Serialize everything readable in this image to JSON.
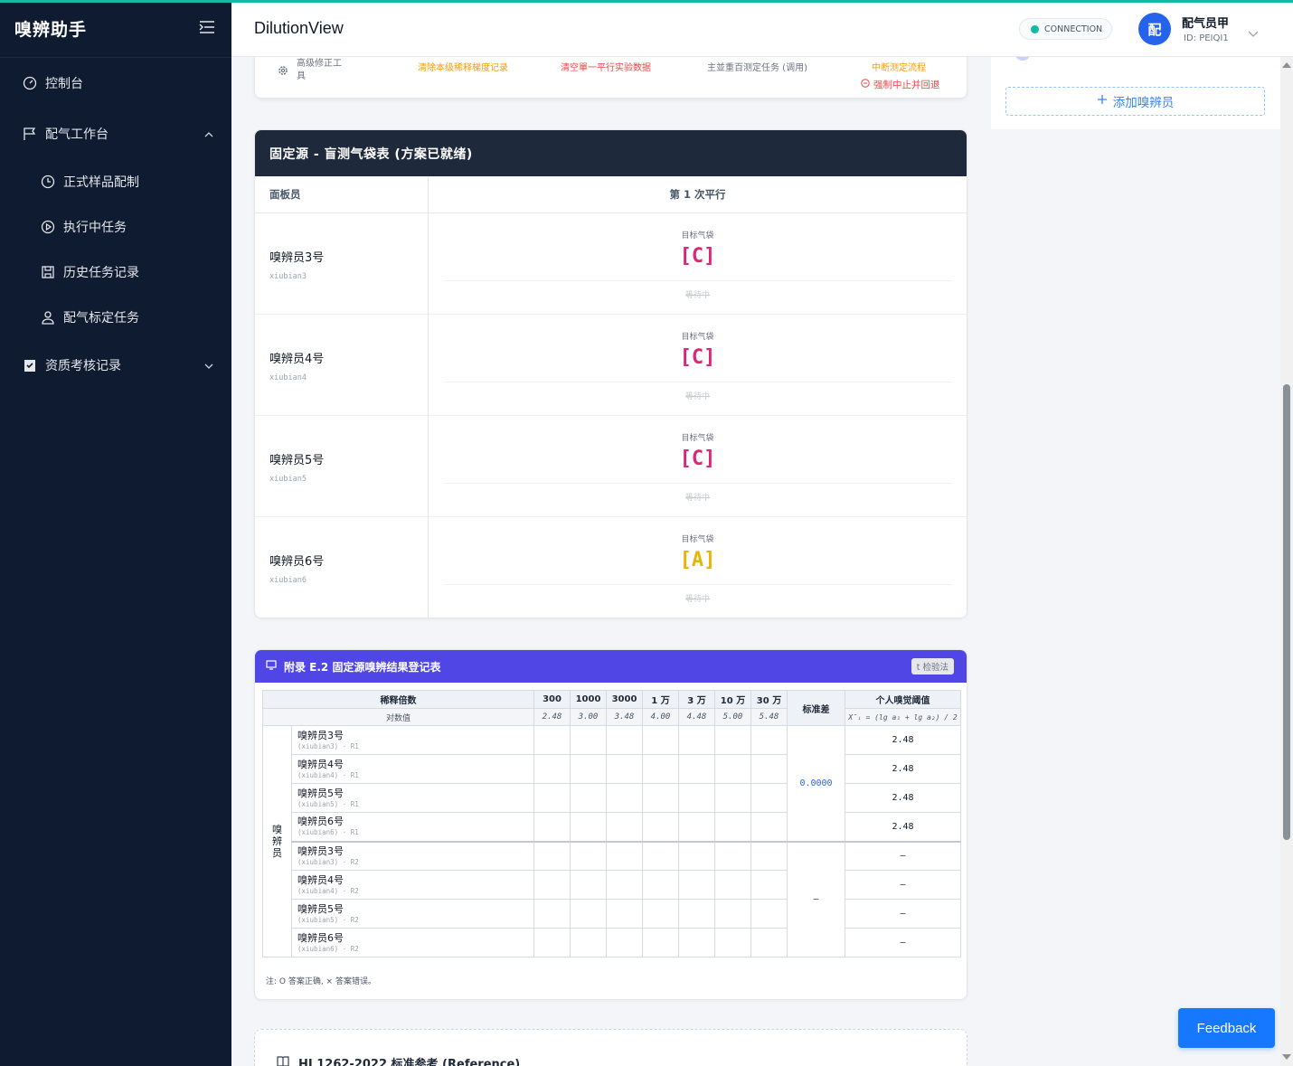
{
  "sidebar": {
    "brand": "嗅辨助手",
    "items": {
      "dashboard": "控制台",
      "workbench": "配气工作台",
      "formal": "正式样品配制",
      "running": "执行中任务",
      "history": "历史任务记录",
      "calibration": "配气标定任务",
      "qualification": "资质考核记录"
    }
  },
  "header": {
    "title": "DilutionView",
    "connection": "CONNECTION",
    "user_avatar": "配",
    "user_name": "配气员甲",
    "user_id": "ID: PEIQI1"
  },
  "ops": {
    "advanced": "高级修正工具",
    "row_items": [
      "清除本级稀释梯度记录",
      "清空單一平行实验数据",
      "主並重百测定任务 (调用)",
      "中断测定流程"
    ],
    "force_stop": "强制中止并回退"
  },
  "blind": {
    "title": "固定源 - 盲测气袋表 (方案已就绪)",
    "col_panelist": "面板员",
    "col_round": "第 1 次平行",
    "target_label": "目标气袋",
    "waiting": "等待中",
    "rows": [
      {
        "name": "嗅辨员3号",
        "id": "xiubian3",
        "bag": "[C]"
      },
      {
        "name": "嗅辨员4号",
        "id": "xiubian4",
        "bag": "[C]"
      },
      {
        "name": "嗅辨员5号",
        "id": "xiubian5",
        "bag": "[C]"
      },
      {
        "name": "嗅辨员6号",
        "id": "xiubian6",
        "bag": "[A]"
      }
    ]
  },
  "appendix": {
    "title": "附录 E.2 固定源嗅辨结果登记表",
    "t_test": "t 检验法",
    "dilution_header": "稀释倍数",
    "log_header": "对数值",
    "dilutions": [
      "300",
      "1000",
      "3000",
      "1 万",
      "3 万",
      "10 万",
      "30 万"
    ],
    "logs": [
      "2.48",
      "3.00",
      "3.48",
      "4.00",
      "4.48",
      "5.00",
      "5.48"
    ],
    "std_header": "标准差",
    "threshold_header": "个人嗅觉阈值",
    "formula": "X̄ᵢ = (lg a₁ + lg a₂) / 2",
    "group_label": "嗅辨员",
    "rows": [
      {
        "name": "嗅辨员3号",
        "sub": "(xiubian3) · R1",
        "threshold": "2.48"
      },
      {
        "name": "嗅辨员4号",
        "sub": "(xiubian4) · R1",
        "threshold": "2.48"
      },
      {
        "name": "嗅辨员5号",
        "sub": "(xiubian5) · R1",
        "threshold": "2.48"
      },
      {
        "name": "嗅辨员6号",
        "sub": "(xiubian6) · R1",
        "threshold": "2.48"
      },
      {
        "name": "嗅辨员3号",
        "sub": "(xiubian3) · R2",
        "threshold": "—"
      },
      {
        "name": "嗅辨员4号",
        "sub": "(xiubian4) · R2",
        "threshold": "—"
      },
      {
        "name": "嗅辨员5号",
        "sub": "(xiubian5) · R2",
        "threshold": "—"
      },
      {
        "name": "嗅辨员6号",
        "sub": "(xiubian6) · R2",
        "threshold": "—"
      }
    ],
    "std_r1": "0.0000",
    "std_r2": "—",
    "note": "注: O 答案正确, × 答案错误。"
  },
  "reference": {
    "title": "HJ 1262-2022 标准参考 (Reference)"
  },
  "right_panel": {
    "add_label": "添加嗅辨员"
  },
  "feedback": "Feedback",
  "colors": {
    "sidebar": "#0f1b30",
    "accent": "#14b8a6",
    "bag_c": "#db2777",
    "bag_a": "#eab308",
    "appendix": "#4f46e5",
    "primary": "#1677ff"
  }
}
